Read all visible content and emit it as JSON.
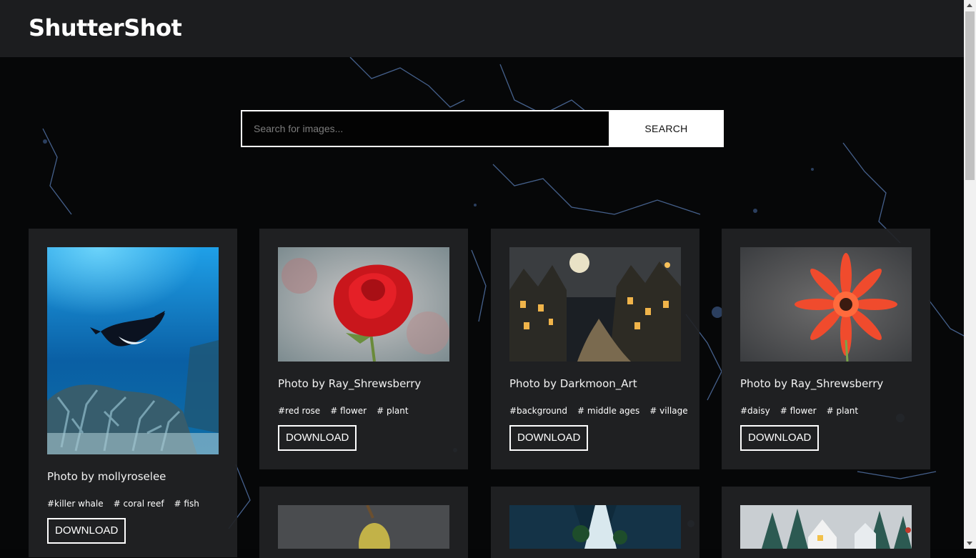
{
  "header": {
    "logo": "ShutterShot"
  },
  "search": {
    "placeholder": "Search for images...",
    "button_label": "SEARCH"
  },
  "cards": [
    {
      "credit": "Photo by mollyroselee",
      "tags": [
        "#killer whale",
        "# coral reef",
        "# fish"
      ],
      "download_label": "DOWNLOAD"
    },
    {
      "credit": "Photo by Ray_Shrewsberry",
      "tags": [
        "#red rose",
        "# flower",
        "# plant"
      ],
      "download_label": "DOWNLOAD"
    },
    {
      "credit": "Photo by Darkmoon_Art",
      "tags": [
        "#background",
        "# middle ages",
        "# village"
      ],
      "download_label": "DOWNLOAD"
    },
    {
      "credit": "Photo by Ray_Shrewsberry",
      "tags": [
        "#daisy",
        "# flower",
        "# plant"
      ],
      "download_label": "DOWNLOAD"
    }
  ],
  "colors": {
    "header_bg": "#1c1d1f",
    "card_bg": "#222325",
    "page_bg": "#050607",
    "accent": "#ffffff"
  }
}
